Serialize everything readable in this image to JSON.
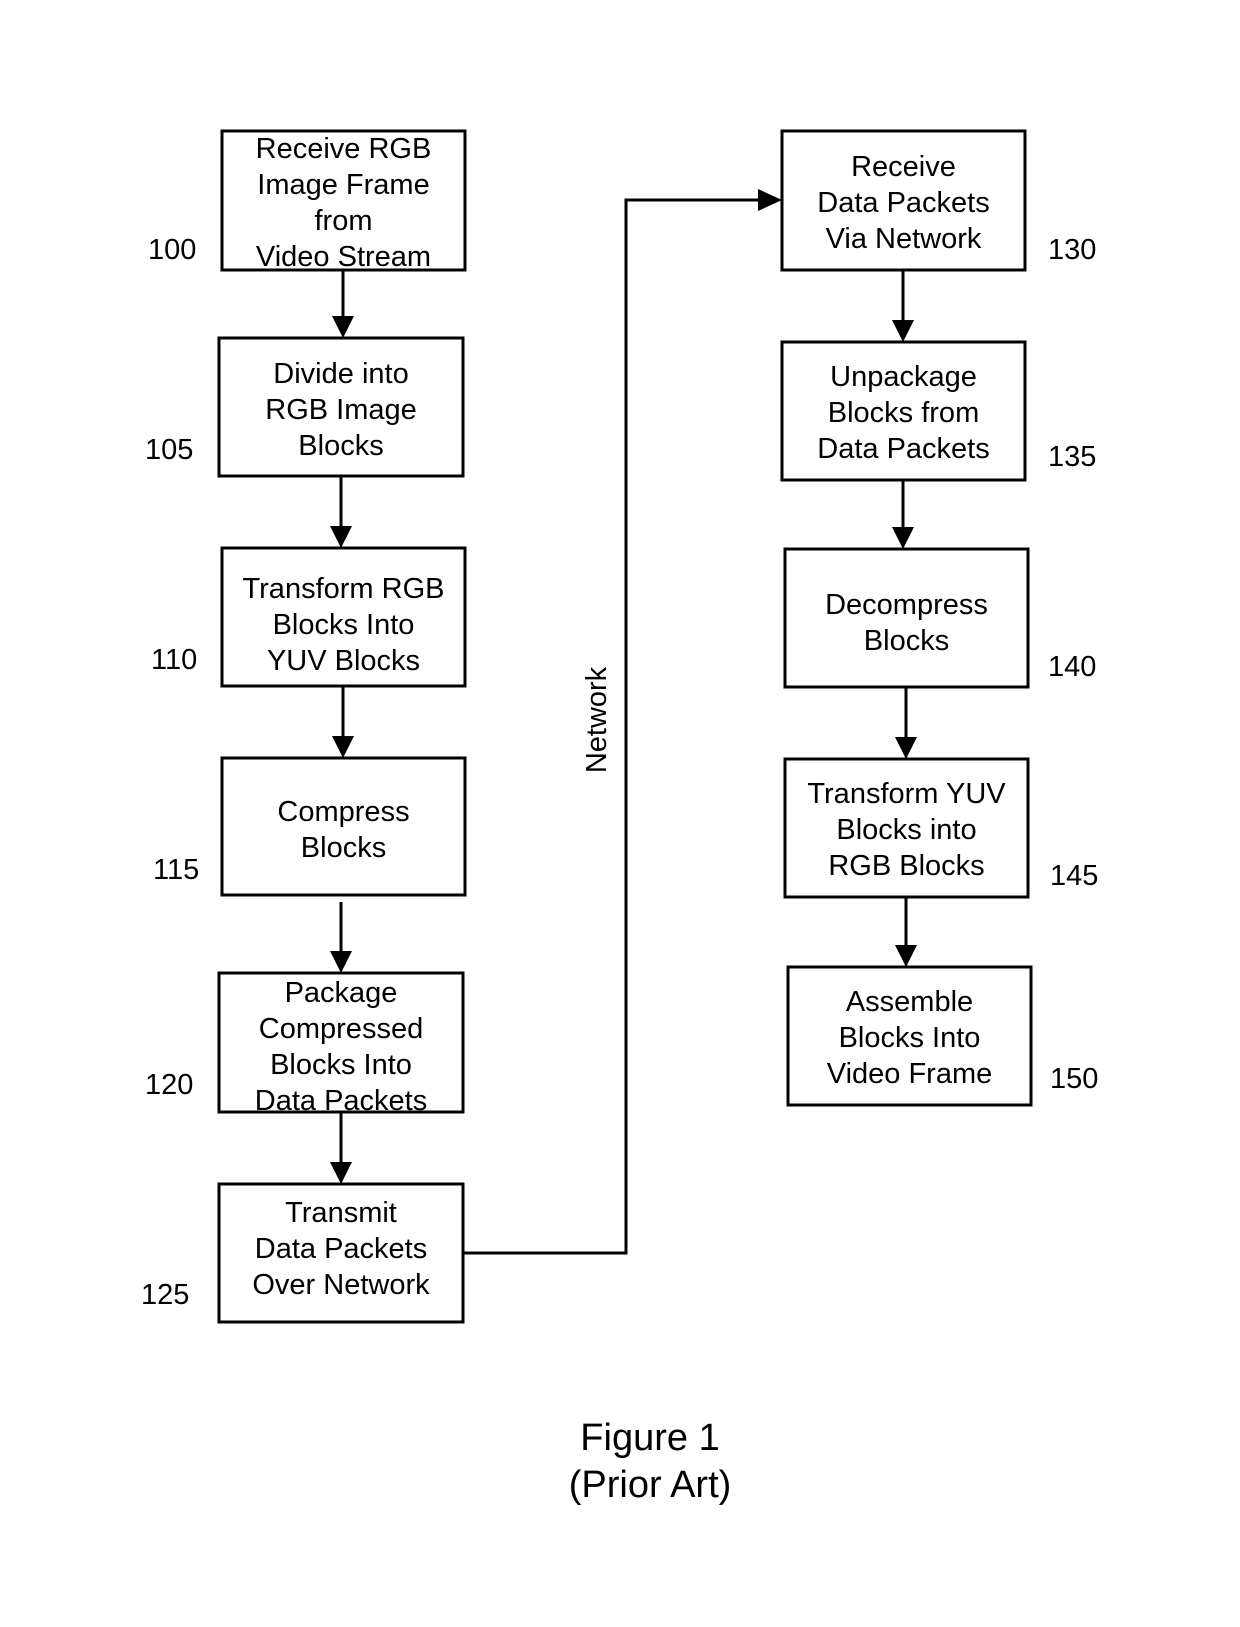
{
  "steps": [
    {
      "ref": "100",
      "lines": [
        "Receive RGB",
        "Image Frame",
        "from",
        "Video Stream"
      ]
    },
    {
      "ref": "105",
      "lines": [
        "Divide into",
        "RGB Image",
        "Blocks"
      ]
    },
    {
      "ref": "110",
      "lines": [
        "Transform RGB",
        "Blocks Into",
        "YUV Blocks"
      ]
    },
    {
      "ref": "115",
      "lines": [
        "Compress",
        "Blocks"
      ]
    },
    {
      "ref": "120",
      "lines": [
        "Package",
        "Compressed",
        "Blocks Into",
        "Data Packets"
      ]
    },
    {
      "ref": "125",
      "lines": [
        "Transmit",
        "Data Packets",
        "Over Network"
      ]
    },
    {
      "ref": "130",
      "lines": [
        "Receive",
        "Data Packets",
        "Via Network"
      ]
    },
    {
      "ref": "135",
      "lines": [
        "Unpackage",
        "Blocks from",
        "Data Packets"
      ]
    },
    {
      "ref": "140",
      "lines": [
        "Decompress",
        "Blocks"
      ]
    },
    {
      "ref": "145",
      "lines": [
        "Transform YUV",
        "Blocks into",
        "RGB Blocks"
      ]
    },
    {
      "ref": "150",
      "lines": [
        "Assemble",
        "Blocks Into",
        "Video Frame"
      ]
    }
  ],
  "network_label": "Network",
  "caption": {
    "line1": "Figure 1",
    "line2": "(Prior Art)"
  }
}
